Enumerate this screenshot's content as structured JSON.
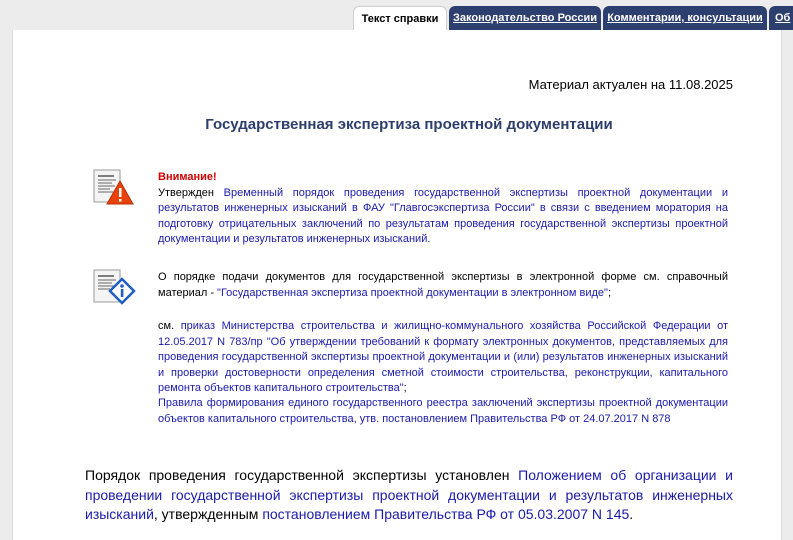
{
  "tabs": [
    {
      "label": "Текст справки",
      "active": true
    },
    {
      "label": "Законодательство России",
      "active": false
    },
    {
      "label": "Комментарии, консультации",
      "active": false
    },
    {
      "label": "Об",
      "active": false
    }
  ],
  "actual_text": "Материал актуален на 11.08.2025",
  "title": "Государственная экспертиза проектной документации",
  "warning": {
    "heading": "Внимание!",
    "prefix": "Утвержден ",
    "link": "Временный порядок проведения государственной экспертизы проектной документации и результатов инженерных изысканий в ФАУ \"Главгосэкспертиза России\" в связи с введением моратория на подготовку отрицательных заключений по результатам проведения государственной экспертизы проектной документации и результатов инженерных изысканий."
  },
  "info": {
    "text": "О порядке подачи документов для государственной экспертизы в электронной форме см. справочный материал - ",
    "link": "\"Государственная экспертиза проектной документации в электронном виде\"",
    "suffix": ";",
    "see_prefix": "см. ",
    "see_link": "приказ Министерства строительства и жилищно-коммунального хозяйства Российской Федерации от 12.05.2017 N 783/пр \"Об утверждении требований к формату электронных документов, представляемых для проведения государственной экспертизы проектной документации и (или) результатов инженерных изысканий и проверки достоверности определения сметной стоимости строительства, реконструкции, капитального ремонта объектов капитального строительства\"",
    "see_suffix": ";",
    "rules_link": "Правила формирования единого государственного реестра заключений экспертизы проектной документации объектов капитального строительства, утв. постановлением Правительства РФ от 24.07.2017 N 878"
  },
  "main": {
    "prefix": "Порядок проведения государственной экспертизы установлен ",
    "link1": "Положением об организации и проведении государственной экспертизы проектной документации и результатов инженерных изысканий",
    "middle": ", утвержденным ",
    "link2": "постановлением Правительства РФ от 05.03.2007 N 145",
    "suffix": "."
  },
  "colors": {
    "tab_active_bg": "#ffffff",
    "tab_inactive_bg": "#2d3f6e",
    "title": "#2d3e6d",
    "link": "#1a1aa8",
    "warning": "#d00000"
  },
  "icons": [
    "document-warning-icon",
    "document-info-icon"
  ]
}
